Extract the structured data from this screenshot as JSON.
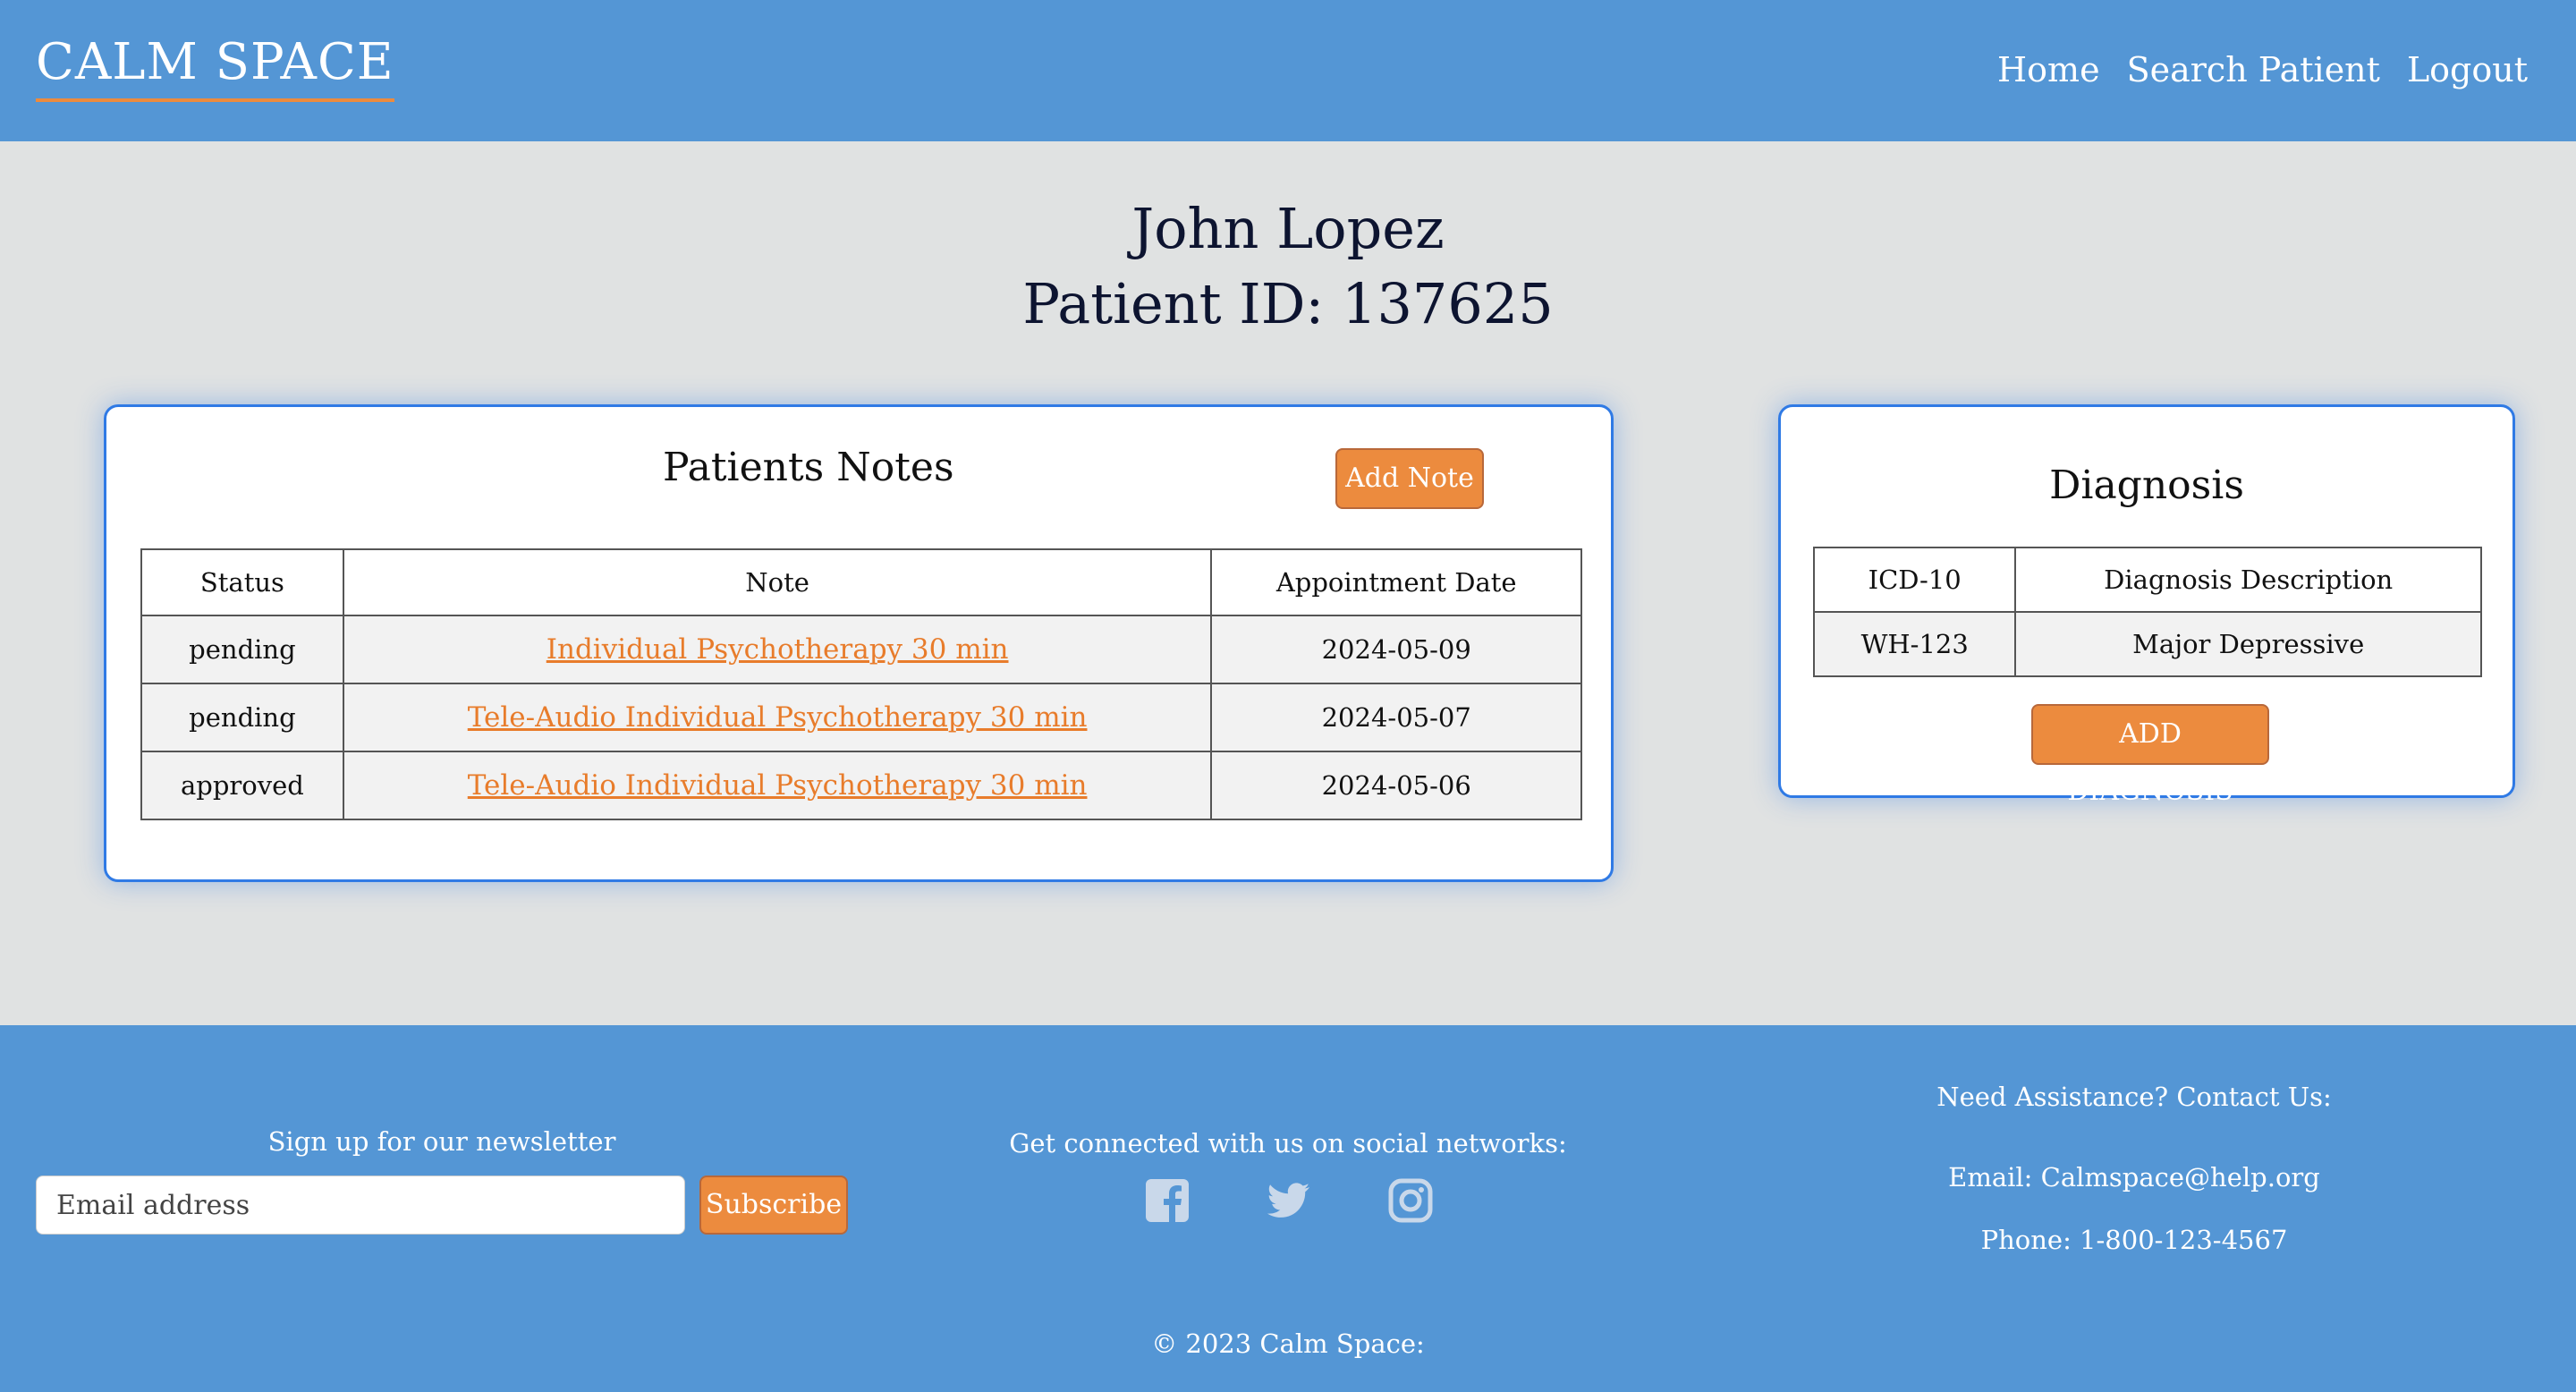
{
  "navbar": {
    "brand": "CALM SPACE",
    "links": [
      "Home",
      "Search Patient",
      "Logout"
    ]
  },
  "patient": {
    "name": "John Lopez",
    "id_line": "Patient ID: 137625"
  },
  "notes": {
    "title": "Patients Notes",
    "add_button": "Add Note",
    "columns": [
      "Status",
      "Note",
      "Appointment Date"
    ],
    "rows": [
      {
        "status": "pending",
        "note": "Individual Psychotherapy 30 min",
        "date": "2024-05-09"
      },
      {
        "status": "pending",
        "note": "Tele-Audio Individual Psychotherapy 30 min",
        "date": "2024-05-07"
      },
      {
        "status": "approved",
        "note": "Tele-Audio Individual Psychotherapy 30 min",
        "date": "2024-05-06"
      }
    ]
  },
  "diagnosis": {
    "title": "Diagnosis",
    "columns": [
      "ICD-10",
      "Diagnosis Description"
    ],
    "rows": [
      {
        "code": "WH-123",
        "description": "Major Depressive"
      }
    ],
    "add_button": "ADD DIAGNOSIS"
  },
  "footer": {
    "newsletter_label": "Sign up for our newsletter",
    "email_placeholder": "Email address",
    "subscribe_button": "Subscribe",
    "social_label": "Get connected with us on social networks:",
    "social_icons": [
      "facebook-icon",
      "twitter-icon",
      "instagram-icon"
    ],
    "contact_label": "Need Assistance? Contact Us:",
    "contact_email": "Email: Calmspace@help.org",
    "contact_phone": "Phone: 1-800-123-4567",
    "copyright": "© 2023 Calm Space:"
  },
  "colors": {
    "primary": "#5496d5",
    "accent": "#ec8b3e",
    "background": "#e0e2e2",
    "card_border": "#2f7ae5"
  }
}
